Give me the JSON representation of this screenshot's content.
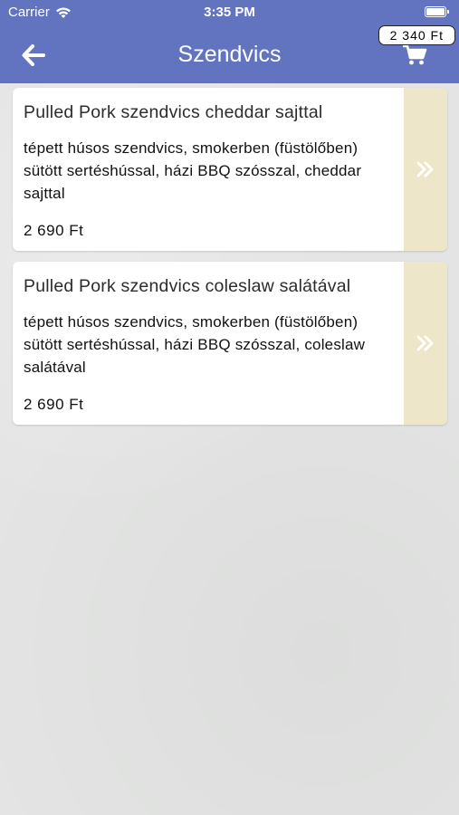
{
  "status_bar": {
    "carrier": "Carrier",
    "time": "3:35 PM"
  },
  "header": {
    "title": "Szendvics",
    "cart_total": "2 340 Ft",
    "back_icon": "arrow-left-icon",
    "cart_icon": "shopping-cart-icon"
  },
  "products": [
    {
      "title": "Pulled Pork szendvics cheddar sajttal",
      "description": "tépett húsos szendvics, smokerben (füstölőben) sütött sertéshússal, házi BBQ szósszal, cheddar sajttal",
      "price": "2 690 Ft"
    },
    {
      "title": "Pulled Pork szendvics coleslaw salátával",
      "description": "tépett húsos szendvics, smokerben (füstölőben) sütött sertéshússal, házi BBQ szósszal, coleslaw salátával",
      "price": "2 690 Ft"
    }
  ],
  "colors": {
    "header_bg": "#6273c0",
    "arrow_panel": "#ede6c8",
    "page_bg": "#e3e4e3"
  }
}
